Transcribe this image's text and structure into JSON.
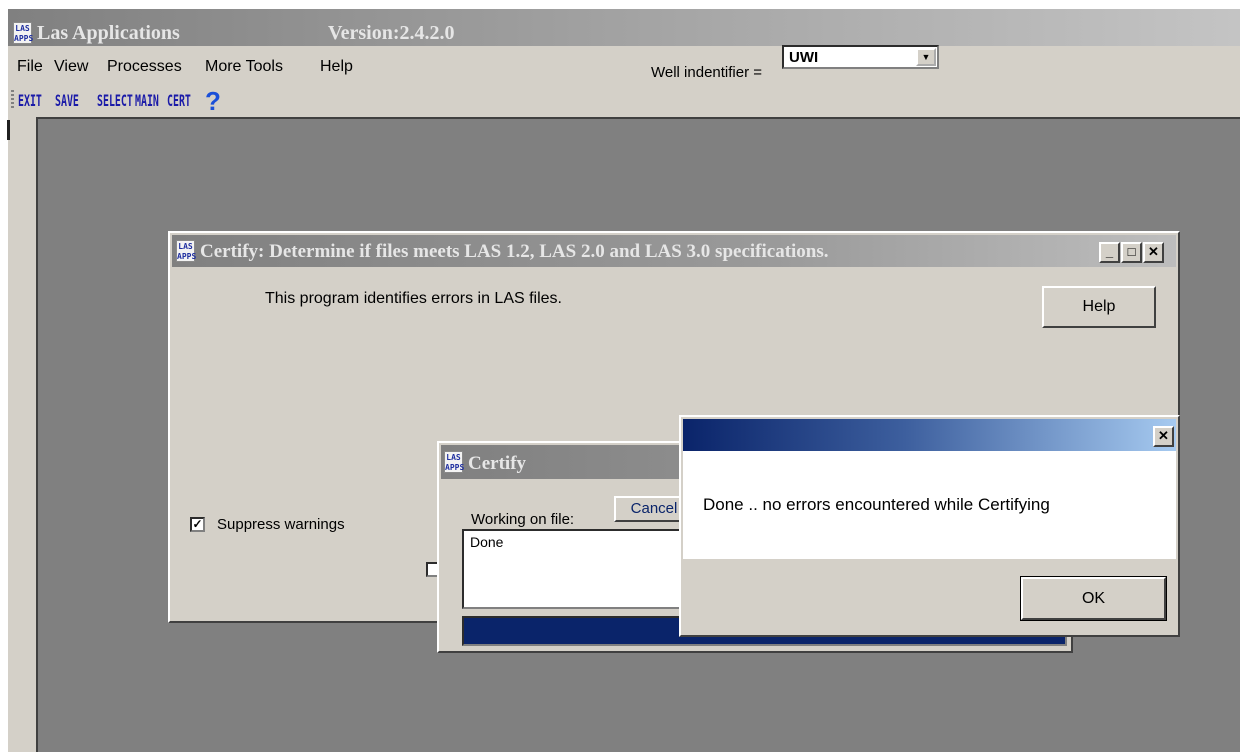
{
  "app": {
    "title": "Las Applications",
    "version": "Version:2.4.2.0",
    "logo": {
      "line1": "LAS",
      "line2": "APPS"
    }
  },
  "menu": {
    "items": [
      "File",
      "View",
      "Processes",
      "More Tools",
      "Help"
    ],
    "well_label": "Well indentifier =",
    "well_value": "UWI"
  },
  "toolbar": {
    "buttons": [
      "EXIT",
      "SAVE",
      "SELECT",
      "MAIN",
      "CERT"
    ],
    "help_glyph": "?"
  },
  "certify_dialog": {
    "title": "Certify: Determine if files meets LAS 1.2, LAS 2.0 and LAS 3.0 specifications.",
    "intro": "This program identifies errors in LAS files.",
    "help_label": "Help",
    "minimize_glyph": "_",
    "maximize_glyph": "□",
    "close_glyph": "✕",
    "suppress_label": "Suppress warnings",
    "suppress_checked": "✓"
  },
  "progress_dialog": {
    "title": "Certify",
    "cancel_label": "Cancel",
    "working_label": "Working on file:",
    "file_text": "Done",
    "progress": 1.0
  },
  "message_box": {
    "close_glyph": "✕",
    "text": "Done .. no errors encountered while Certifying",
    "ok_label": "OK"
  }
}
